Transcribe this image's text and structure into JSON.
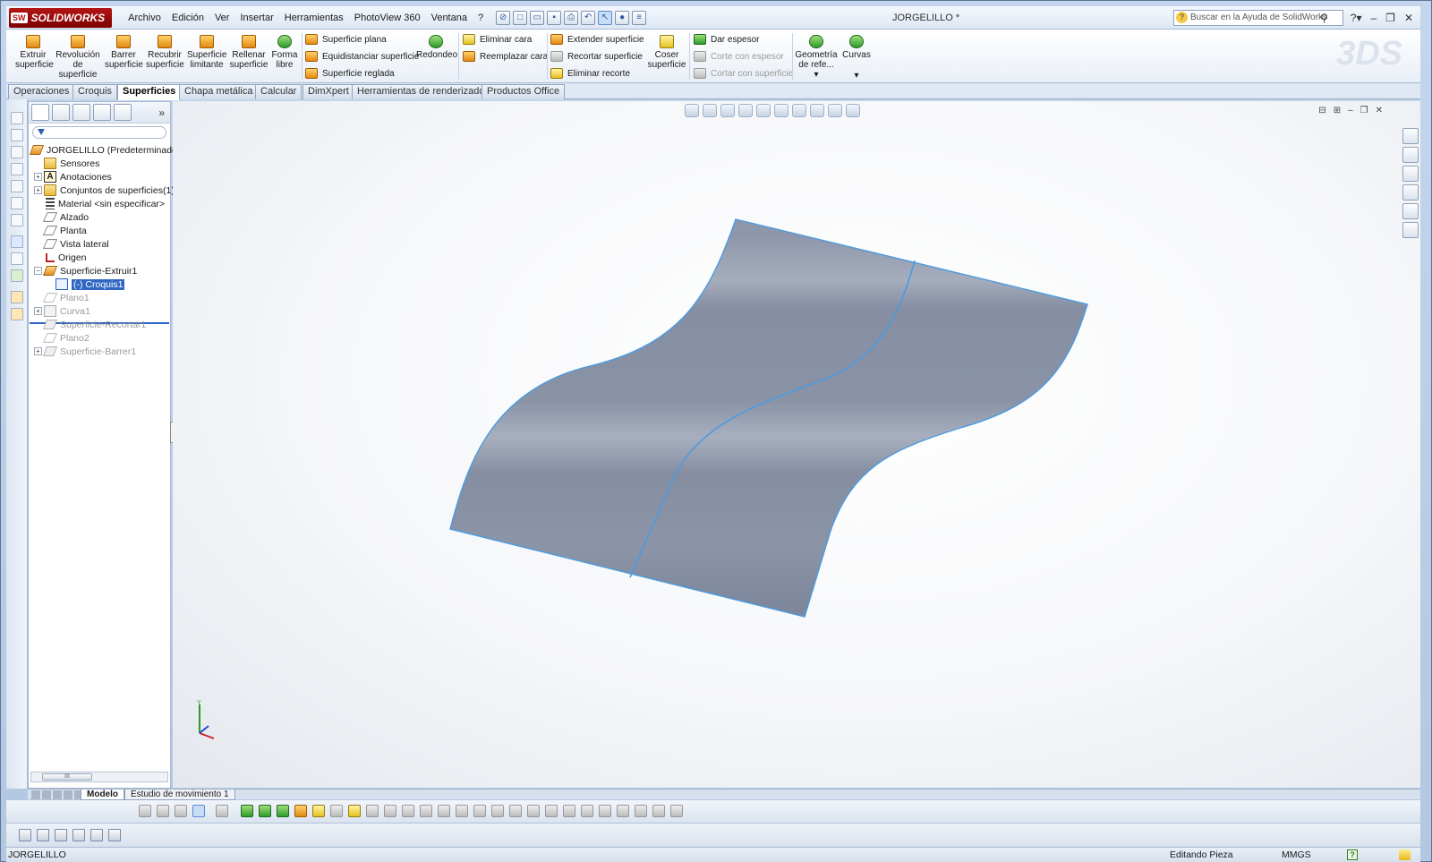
{
  "app": {
    "brand": "SOLIDWORKS",
    "brand_badge": "SW",
    "doc_title": "JORGELILLO *"
  },
  "menu": [
    "Archivo",
    "Edición",
    "Ver",
    "Insertar",
    "Herramientas",
    "PhotoView 360",
    "Ventana",
    "?"
  ],
  "search": {
    "placeholder": "Buscar en la Ayuda de SolidWorks"
  },
  "ribbon": {
    "big_tools": [
      {
        "label1": "Extruir",
        "label2": "superficie",
        "label3": ""
      },
      {
        "label1": "Revolución",
        "label2": "de",
        "label3": "superficie"
      },
      {
        "label1": "Barrer",
        "label2": "superficie",
        "label3": ""
      },
      {
        "label1": "Recubrir",
        "label2": "superficie",
        "label3": ""
      },
      {
        "label1": "Superficie",
        "label2": "limitante",
        "label3": ""
      },
      {
        "label1": "Rellenar",
        "label2": "superficie",
        "label3": ""
      },
      {
        "label1": "Forma",
        "label2": "libre",
        "label3": ""
      }
    ],
    "col1": [
      "Superficie plana",
      "Equidistanciar superficie",
      "Superficie reglada"
    ],
    "redondeo": "Redondeo",
    "col2": [
      "Eliminar cara",
      "Reemplazar cara"
    ],
    "col3": [
      "Extender superficie",
      "Recortar superficie",
      "Eliminar recorte"
    ],
    "coser": {
      "label1": "Coser",
      "label2": "superficie"
    },
    "col4": [
      "Dar espesor",
      "Corte con espesor",
      "Cortar con superficie"
    ],
    "geom": {
      "label1": "Geometría",
      "label2": "de refe..."
    },
    "curvas": "Curvas"
  },
  "tabs": [
    "Operaciones",
    "Croquis",
    "Superficies",
    "Chapa metálica",
    "Calcular",
    "DimXpert",
    "Herramientas de renderizado",
    "Productos Office"
  ],
  "active_tab": "Superficies",
  "tree": {
    "root": "JORGELILLO  (Predeterminado<",
    "items": [
      {
        "label": "Sensores",
        "icon": "sensor-folder-icon"
      },
      {
        "label": "Anotaciones",
        "icon": "annotations-icon"
      },
      {
        "label": "Conjuntos de superficies(1)",
        "icon": "surface-bodies-icon"
      },
      {
        "label": "Material <sin especificar>",
        "icon": "material-icon"
      },
      {
        "label": "Alzado",
        "icon": "plane-icon"
      },
      {
        "label": "Planta",
        "icon": "plane-icon"
      },
      {
        "label": "Vista lateral",
        "icon": "plane-icon"
      },
      {
        "label": "Origen",
        "icon": "origin-icon"
      },
      {
        "label": "Superficie-Extruir1",
        "icon": "extrude-surface-icon"
      },
      {
        "label": "(-) Croquis1",
        "icon": "sketch-icon"
      },
      {
        "label": "Plano1",
        "icon": "plane-icon"
      },
      {
        "label": "Curva1",
        "icon": "curve-icon"
      },
      {
        "label": "Superficie-Recortar1",
        "icon": "trim-surface-icon"
      },
      {
        "label": "Plano2",
        "icon": "plane-icon"
      },
      {
        "label": "Superficie-Barrer1",
        "icon": "sweep-surface-icon"
      }
    ],
    "scroll_label": "III"
  },
  "bottom_tabs": [
    "Modelo",
    "Estudio de movimiento 1"
  ],
  "status": {
    "left": "JORGELILLO",
    "mode": "Editando Pieza",
    "units": "MMGS"
  },
  "colors": {
    "surface": "#8a93a6",
    "edge": "#4a9be0",
    "titlebar": "#dde7f4",
    "brand": "#b31515"
  }
}
